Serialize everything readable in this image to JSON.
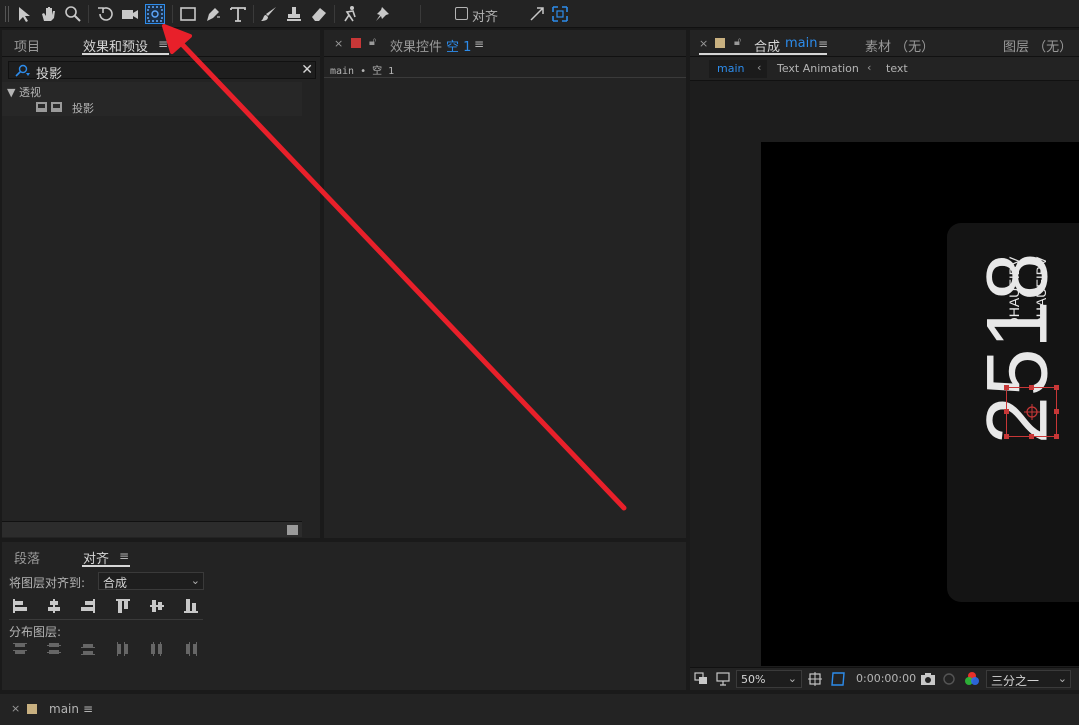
{
  "toolbar": {
    "tools": [
      {
        "name": "selection-icon"
      },
      {
        "name": "hand-icon"
      },
      {
        "name": "zoom-icon"
      },
      {
        "name": "rotate-icon"
      },
      {
        "name": "camera-icon"
      },
      {
        "name": "pan-behind-icon"
      },
      {
        "name": "rectangle-icon"
      },
      {
        "name": "pen-icon"
      },
      {
        "name": "type-icon"
      },
      {
        "name": "brush-icon"
      },
      {
        "name": "clone-stamp-icon"
      },
      {
        "name": "eraser-icon"
      },
      {
        "name": "roto-brush-icon"
      },
      {
        "name": "puppet-pin-icon"
      }
    ],
    "align_label": "对齐"
  },
  "left_panel": {
    "tab_project": "项目",
    "tab_effects": "效果和预设",
    "search_value": "投影",
    "tree_category": "▼ 透视",
    "tree_item": "投影"
  },
  "effect_controls": {
    "title": "效果控件",
    "layer_name": "空 1",
    "breadcrumb": "main • 空 1"
  },
  "composition": {
    "title": "合成",
    "comp_name": "main",
    "footage_tab": "素材  （无）",
    "layer_tab": "图层  （无）",
    "crumbs": [
      "main",
      "Text Animation",
      "text"
    ],
    "canvas_text_big": "2518",
    "canvas_text_vertical_1": "DHAUFIBV",
    "canvas_text_vertical_2": "DHAUFIBV",
    "zoom": "50%",
    "timecode": "0:00:00:00",
    "resolution": "三分之一"
  },
  "align_panel": {
    "tab_paragraph": "段落",
    "tab_align": "对齐",
    "align_to_label": "将图层对齐到:",
    "align_to_value": "合成",
    "distribute_label": "分布图层:"
  },
  "timeline": {
    "comp_name": "main"
  },
  "colors": {
    "accent": "#2d8ceb",
    "arrow": "#e8202a",
    "selection": "#c83737"
  }
}
